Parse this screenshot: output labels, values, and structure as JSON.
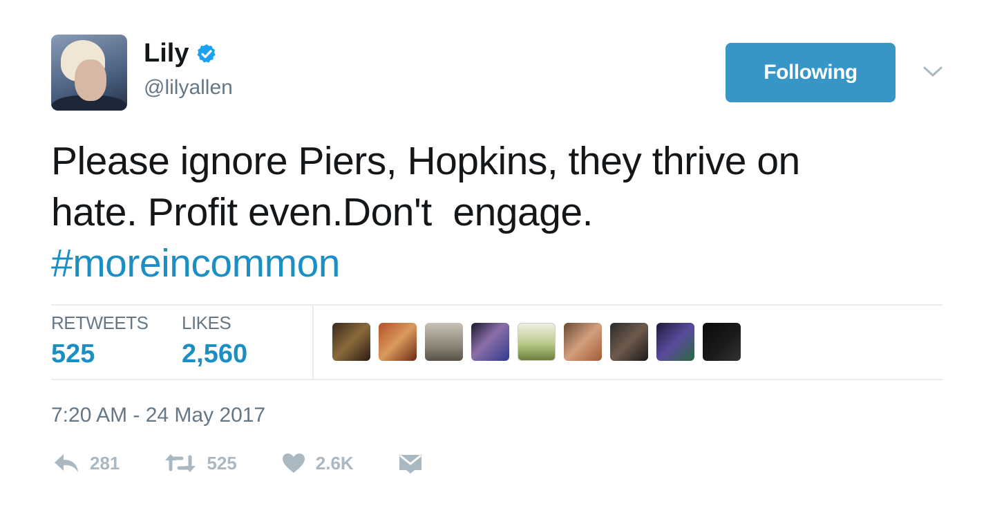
{
  "author": {
    "name": "Lily",
    "handle": "@lilyallen",
    "verified": true
  },
  "follow_button": {
    "label": "Following"
  },
  "tweet": {
    "lines": [
      "Please ignore Piers, Hopkins, they thrive on",
      "hate. Profit even.Don't  engage."
    ],
    "hashtag": "#moreincommon"
  },
  "stats": {
    "retweets": {
      "label": "RETWEETS",
      "value": "525"
    },
    "likes": {
      "label": "LIKES",
      "value": "2,560"
    }
  },
  "likers_count_shown": 9,
  "timestamp": "7:20 AM - 24 May 2017",
  "actions": {
    "reply": {
      "icon": "reply-icon",
      "count": "281"
    },
    "retweet": {
      "icon": "retweet-icon",
      "count": "525"
    },
    "like": {
      "icon": "heart-icon",
      "count": "2.6K"
    },
    "message": {
      "icon": "envelope-icon"
    }
  },
  "colors": {
    "accent": "#1b8fc4",
    "button": "#3896c6",
    "muted": "#657786",
    "icon_muted": "#aab8c2",
    "verified": "#1da1f2"
  }
}
